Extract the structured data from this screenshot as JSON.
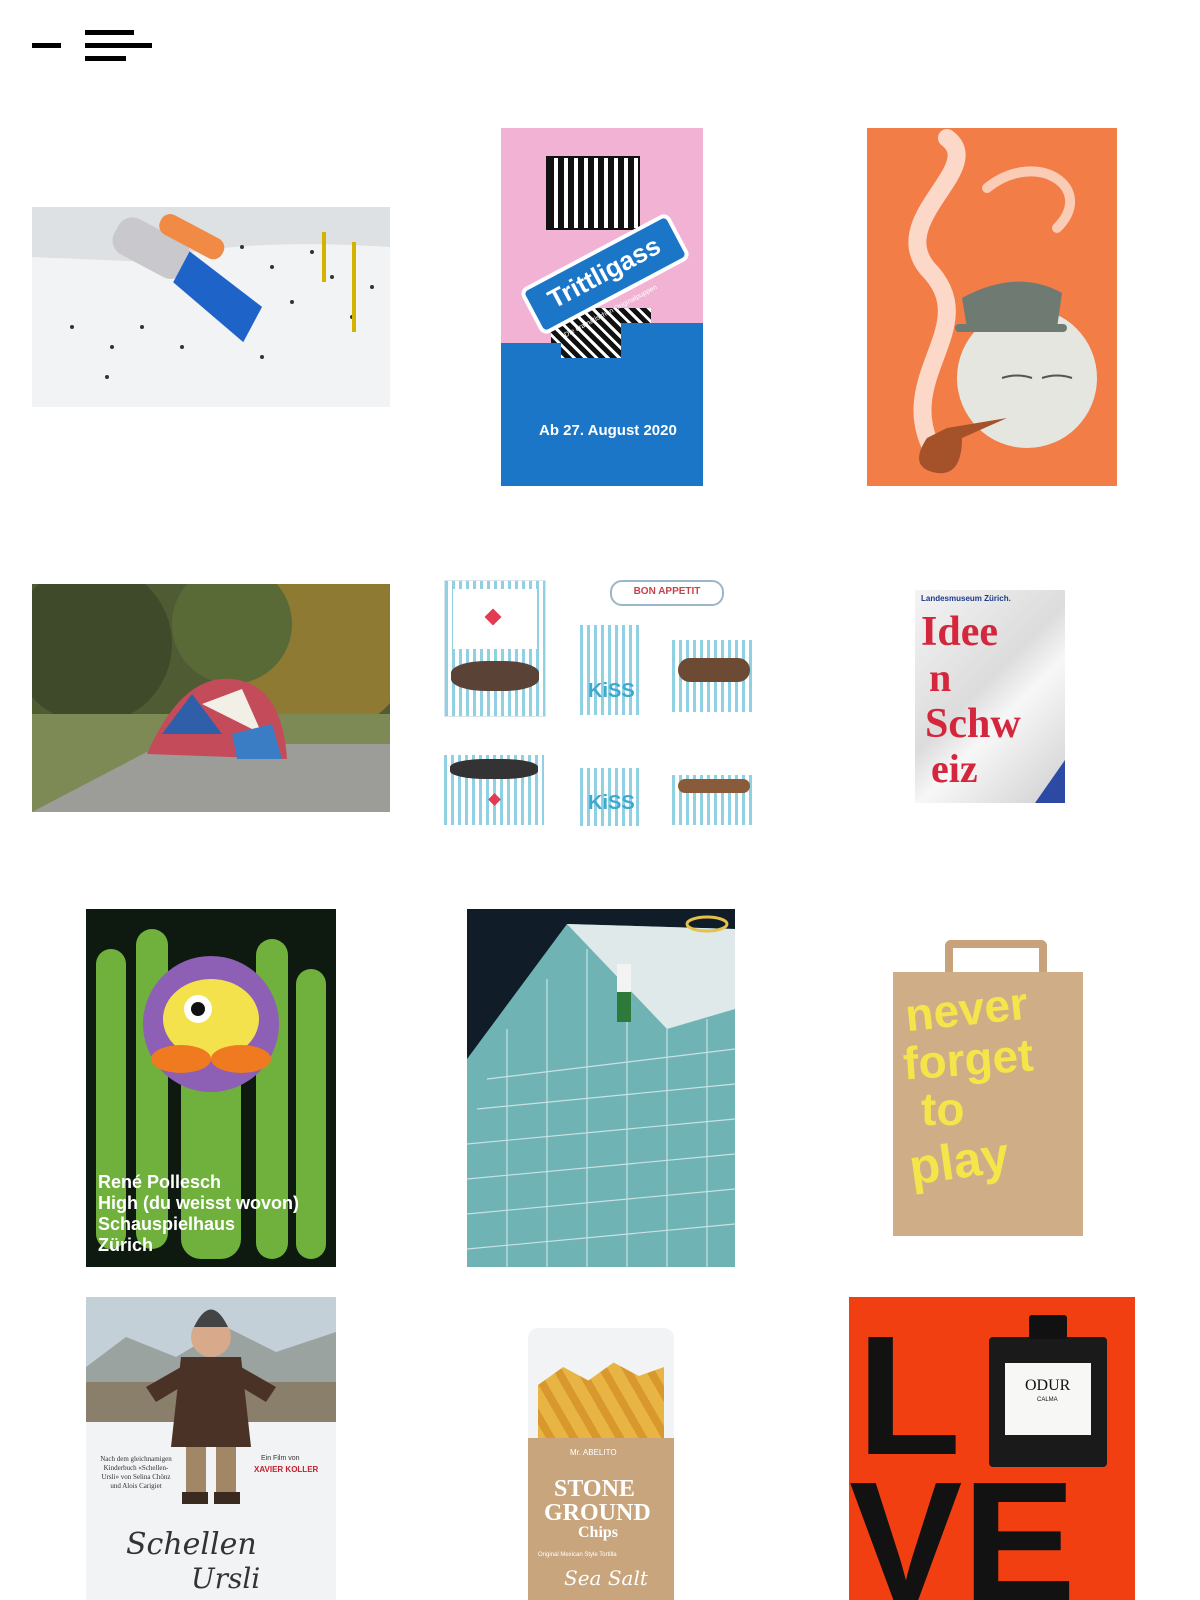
{
  "site": {
    "logo_name": "menu-logo"
  },
  "tiles": [
    {
      "key": "vacuum_ski",
      "alt": "Handheld vacuum over ski slope"
    },
    {
      "key": "trittligass",
      "title": "Trittligass",
      "subtitle": "Die dramatischen Originalpuppen",
      "date": "Ab 27. August 2020"
    },
    {
      "key": "pipe_moon",
      "alt": "Moon face smoking a pipe poster"
    },
    {
      "key": "blanket_park",
      "alt": "Patchwork blanket sculpture in park"
    },
    {
      "key": "kiss_boxes",
      "brand_top": "BON APPETIT",
      "box_label": "KiSS"
    },
    {
      "key": "ideen_schweiz",
      "header": "Landesmuseum Zürich.",
      "line1": "Idee",
      "line2": "n",
      "line3": "Schw",
      "line4": "eiz"
    },
    {
      "key": "pollesch",
      "line1": "René Pollesch",
      "line2": "High (du weisst wovon)",
      "line3": "Schauspielhaus",
      "line4": "Zürich"
    },
    {
      "key": "ski_building",
      "alt": "Skier on glass skyscraper"
    },
    {
      "key": "paper_bag",
      "line1": "never",
      "line2": "forget",
      "line3": "to",
      "line4": "play"
    },
    {
      "key": "schellen_ursli",
      "credit_small": "Ein Film von",
      "director": "XAVIER KOLLER",
      "note": "Nach dem gleichnamigen Kinderbuch «Schellen-Ursli» von Selina Chönz und Alois Carigiet",
      "title1": "Schellen",
      "title2": "Ursli"
    },
    {
      "key": "chips",
      "brand": "Mr. ABELITO",
      "line1": "STONE",
      "line2": "GROUND",
      "line3": "Chips",
      "tag": "Original Mexican Style Tortilla",
      "flavor": "Sea Salt"
    },
    {
      "key": "odur",
      "word_top": "L",
      "word_bottom": "VE",
      "bottle_brand": "ODUR",
      "bottle_sub": "CALMA"
    }
  ]
}
